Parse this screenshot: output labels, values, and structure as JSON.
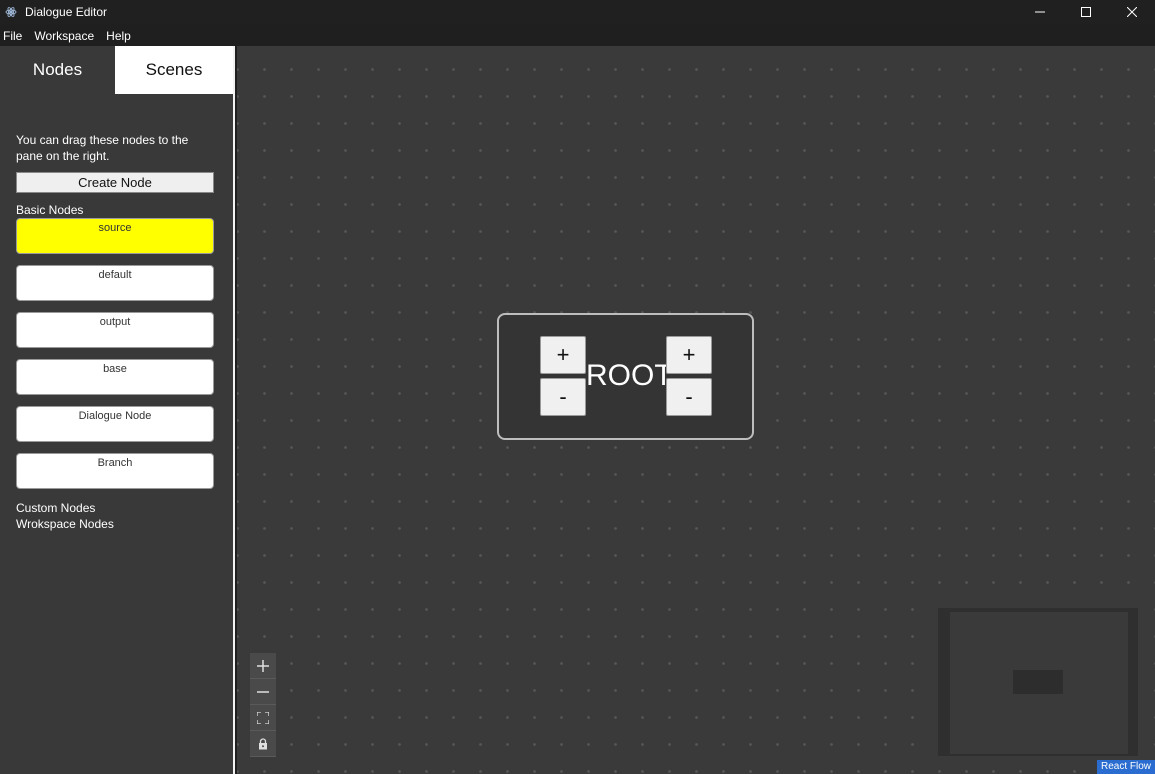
{
  "window": {
    "title": "Dialogue Editor",
    "controls": {
      "minimize": "—",
      "maximize": "☐",
      "close": "✕"
    }
  },
  "menu": [
    "File",
    "Workspace",
    "Help"
  ],
  "sidebar": {
    "tabs": [
      {
        "label": "Nodes",
        "active": true
      },
      {
        "label": "Scenes",
        "active": false
      }
    ],
    "help_text": "You can drag these nodes to the pane on the right.",
    "create_button": "Create Node",
    "basic_label": "Basic Nodes",
    "nodes": [
      "source",
      "default",
      "output",
      "base",
      "Dialogue Node",
      "Branch"
    ],
    "custom_label": "Custom Nodes",
    "workspace_label": "Wrokspace Nodes"
  },
  "canvas": {
    "root_node": {
      "label": "ROOT",
      "add_symbol": "+",
      "remove_symbol": "-"
    },
    "controls": [
      "zoom-in",
      "zoom-out",
      "fit-view",
      "lock"
    ],
    "attribution": "React Flow"
  },
  "colors": {
    "source_node": "#ffff00",
    "canvas_bg": "#3a3a3a",
    "sidebar_bg": "#393939"
  }
}
